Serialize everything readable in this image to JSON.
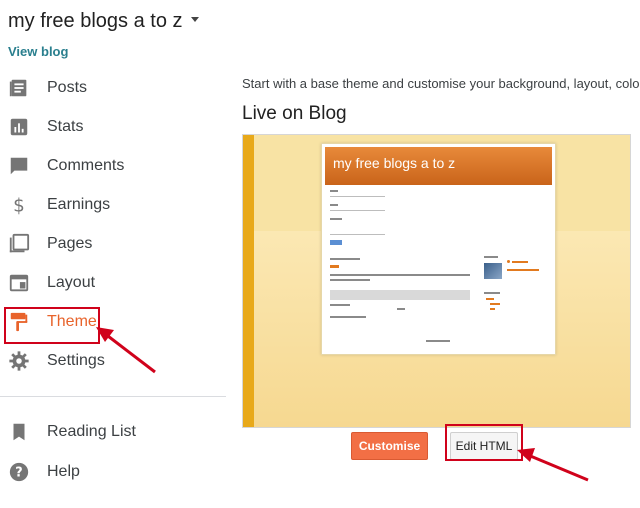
{
  "header": {
    "blog_title": "my free blogs a to z",
    "view_blog": "View blog"
  },
  "sidebar": {
    "items": [
      {
        "label": "Posts",
        "icon": "posts-icon"
      },
      {
        "label": "Stats",
        "icon": "stats-icon"
      },
      {
        "label": "Comments",
        "icon": "comments-icon"
      },
      {
        "label": "Earnings",
        "icon": "dollar-icon"
      },
      {
        "label": "Pages",
        "icon": "pages-icon"
      },
      {
        "label": "Layout",
        "icon": "layout-icon"
      },
      {
        "label": "Theme",
        "icon": "paint-roller-icon",
        "active": true
      },
      {
        "label": "Settings",
        "icon": "gear-icon"
      }
    ],
    "secondary": [
      {
        "label": "Reading List",
        "icon": "bookmark-icon"
      },
      {
        "label": "Help",
        "icon": "help-icon"
      }
    ]
  },
  "main": {
    "intro": "Start with a base theme and customise your background, layout, colour",
    "live_title": "Live on Blog",
    "preview": {
      "blog_title": "my free blogs a to z"
    },
    "buttons": {
      "customise": "Customise",
      "edit_html": "Edit HTML"
    }
  },
  "colors": {
    "accent": "#e8632b",
    "annotation": "#d0021b",
    "customise_button": "#f26f45",
    "link": "#2a7f8e"
  }
}
